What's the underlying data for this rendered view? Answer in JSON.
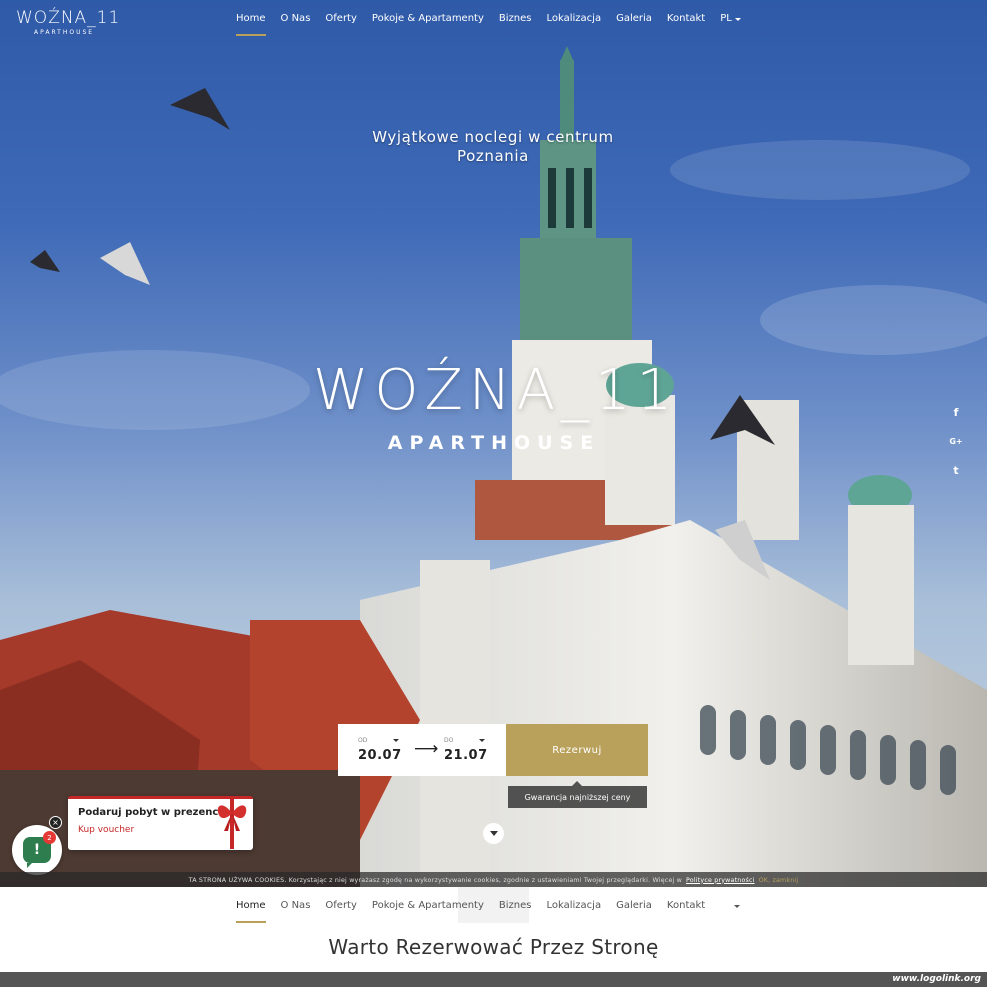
{
  "brand": {
    "name": "WOŹNA_11",
    "subtitle": "APARTHOUSE"
  },
  "nav": {
    "items": [
      "Home",
      "O Nas",
      "Oferty",
      "Pokoje & Apartamenty",
      "Biznes",
      "Lokalizacja",
      "Galeria",
      "Kontakt"
    ],
    "active": "Home",
    "language": "PL"
  },
  "hero": {
    "tagline_line1": "Wyjątkowe noclegi w centrum",
    "tagline_line2": "Poznania"
  },
  "booking": {
    "from_label": "OD",
    "from_value": "20.07",
    "to_label": "DO",
    "to_value": "21.07",
    "arrow": "⟶",
    "reserve_label": "Rezerwuj",
    "guarantee": "Gwarancja najniższej ceny"
  },
  "social": {
    "facebook": "f",
    "google_plus": "G+",
    "twitter": "t",
    "icons": [
      "facebook-icon",
      "google-plus-icon",
      "twitter-icon"
    ]
  },
  "gift_popup": {
    "title": "Podaruj pobyt w prezencie!",
    "link": "Kup voucher",
    "close": "×"
  },
  "chat": {
    "glyph": "!",
    "badge": "2"
  },
  "cookie": {
    "text": "TA STRONA UŻYWA COOKIES. Korzystając z niej wyrażasz zgodę na wykorzystywanie cookies, zgodnie z ustawieniami Twojej przeglądarki. Więcej w",
    "link": "Polityce prywatności",
    "ok": "OK, zamknij"
  },
  "section": {
    "title": "Warto Rezerwować Przez Stronę"
  },
  "watermark": "www.logolink.org",
  "colors": {
    "accent": "#b9a15c",
    "gift_red": "#c62828",
    "chat_green": "#2e7d4f"
  }
}
